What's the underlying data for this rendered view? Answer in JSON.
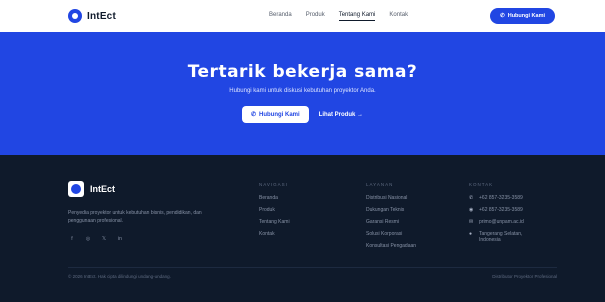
{
  "nav": {
    "logo": "IntEct",
    "links": [
      "Beranda",
      "Produk",
      "Tentang Kami",
      "Kontak"
    ],
    "cta": "Hubungi Kami"
  },
  "hero": {
    "title": "Tertarik bekerja sama?",
    "subtitle": "Hubungi kami untuk diskusi kebutuhan proyektor Anda.",
    "primary": "Hubungi Kami",
    "secondary": "Lihat Produk →"
  },
  "footer": {
    "logo": "IntEct",
    "desc": "Penyedia proyektor untuk kebutuhan bisnis, pendidikan, dan penggunaan profesional.",
    "socials": [
      "f",
      "◎",
      "𝕏",
      "in"
    ],
    "nav_title": "NAVIGASI",
    "nav_items": [
      "Beranda",
      "Produk",
      "Tentang Kami",
      "Kontak"
    ],
    "layanan_title": "LAYANAN",
    "layanan_items": [
      "Distribusi Nasional",
      "Dukungan Teknis",
      "Garansi Resmi",
      "Solusi Korporasi",
      "Konsultasi Pengadaan"
    ],
    "kontak_title": "KONTAK",
    "kontak_items": [
      "+62 857-3235-3589",
      "+62 857-3235-3589",
      "primo@unpam.ac.id",
      "Tangerang Selatan, Indonesia"
    ],
    "copyright": "© 2026 IntEct. Hak cipta dilindungi undang-undang.",
    "tagline": "Distributor Proyektor Profesional"
  },
  "colors": {
    "brand": "#2146e3",
    "dark": "#0f1a2b"
  }
}
